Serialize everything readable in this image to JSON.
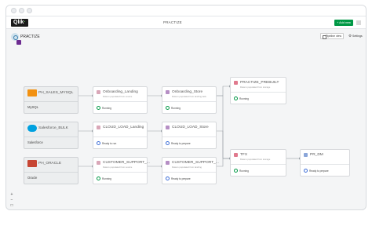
{
  "app": {
    "logo": "Qlik",
    "title": "PRACTIZE",
    "add_new": "+ Add new"
  },
  "project": {
    "name": "PRACTIZE",
    "pipeline_view": "Pipeline view",
    "settings": "Settings"
  },
  "sources": [
    {
      "name": "PH_SALES_MYSQL",
      "sub": "MySQL",
      "logo_color": "#f29111"
    },
    {
      "name": "Salesforce_BULK",
      "sub": "Salesforce",
      "logo_color": "#00a1e0"
    },
    {
      "name": "PH_ORACLE",
      "sub": "Oracle",
      "logo_color": "#c74634"
    }
  ],
  "landing": [
    {
      "name": "Onboarding_Landing",
      "desc": "Data is populated from source",
      "status": "Running"
    },
    {
      "name": "CLOUD_LOAD_Landing",
      "desc": "",
      "status": "Ready to run"
    },
    {
      "name": "CUSTOMER_SUPPORT_...",
      "desc": "Data is populated from source",
      "status": "Running"
    }
  ],
  "storage": [
    {
      "name": "Onboarding_Store",
      "desc": "Data is populated from landing task",
      "status": "Running"
    },
    {
      "name": "CLOUD_LOAD_Store",
      "desc": "",
      "status": "Ready to prepare"
    },
    {
      "name": "CUSTOMER_SUPPORT_...",
      "desc": "Data is populated from landing",
      "status": "Ready to prepare"
    }
  ],
  "transform": [
    {
      "name": "PRACTIZE_PREBUILT",
      "desc": "Data is populated from storage",
      "status": "Running"
    },
    {
      "name": "TFX",
      "desc": "Data is populated from storage",
      "status": "Running"
    }
  ],
  "mart": {
    "name": "PR_DM",
    "desc": "",
    "status": "Ready to prepare"
  },
  "colors": {
    "running": "#009845",
    "ready": "#3d6ed8",
    "landing_icon": "#d9a7b8",
    "storage_icon": "#b68fc5",
    "transform_icon": "#e07a8e",
    "mart_icon": "#8ba6d9"
  },
  "zoom": {
    "plus": "+",
    "minus": "−"
  }
}
